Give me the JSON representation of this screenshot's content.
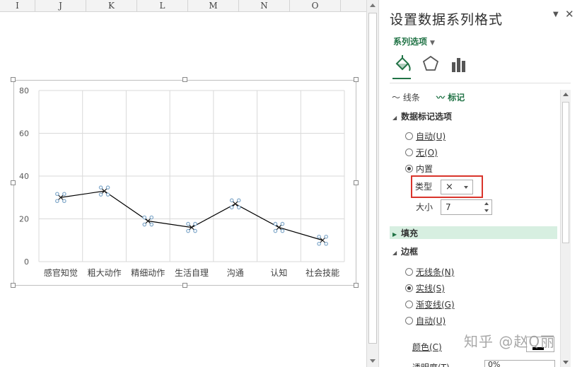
{
  "sheet": {
    "columns": [
      "I",
      "J",
      "K",
      "L",
      "M",
      "N",
      "O"
    ]
  },
  "chart_data": {
    "type": "line",
    "categories": [
      "感官知觉",
      "粗大动作",
      "精细动作",
      "生活自理",
      "沟通",
      "认知",
      "社会技能"
    ],
    "series": [
      {
        "values": [
          30,
          33,
          19,
          16,
          27,
          16,
          10
        ]
      }
    ],
    "yticks": [
      "0",
      "20",
      "40",
      "60",
      "80"
    ],
    "ylim": [
      0,
      80
    ],
    "grid": true,
    "marker": "x",
    "colors": {
      "line": "#000000",
      "marker": "#7fa7c9"
    }
  },
  "pane": {
    "title": "设置数据系列格式",
    "series_options": "系列选项",
    "tabs": [
      "fill-line-icon",
      "effects-icon",
      "series-options-icon"
    ],
    "subtab_line": "线条",
    "subtab_marker": "标记",
    "marker_options_header": "数据标记选项",
    "marker_auto": "自动(U)",
    "marker_none": "无(O)",
    "marker_builtin": "内置",
    "type_label": "类型",
    "type_value": "×",
    "size_label": "大小",
    "size_value": "7",
    "fill_header": "填充",
    "border_header": "边框",
    "border_none": "无线条(N)",
    "border_solid": "实线(S)",
    "border_gradient": "渐变线(G)",
    "border_auto": "自动(U)",
    "color_label": "颜色(C)",
    "transparency_label": "透明度(T)",
    "transparency_value": "0%",
    "accent": "#217346",
    "highlight": "#d9342b"
  },
  "watermark": "知乎 @赵Q丽"
}
